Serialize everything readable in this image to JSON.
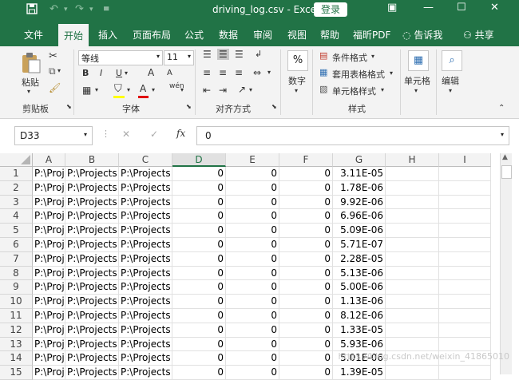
{
  "title": {
    "filename": "driving_log.csv",
    "separator": "-",
    "app": "Excel",
    "login_label": "登录"
  },
  "menu": [
    "文件",
    "开始",
    "插入",
    "页面布局",
    "公式",
    "数据",
    "审阅",
    "视图",
    "帮助",
    "福昕PDF"
  ],
  "tell_me": "告诉我",
  "share": "共享",
  "ribbon": {
    "clipboard": {
      "paste": "粘贴",
      "label": "剪贴板"
    },
    "font": {
      "name": "等线",
      "size": "11",
      "label": "字体",
      "bold": "B",
      "italic": "I",
      "underline": "U",
      "grow": "A",
      "shrink": "A",
      "color": "A",
      "phonetic": "wén"
    },
    "alignment": {
      "label": "对齐方式"
    },
    "number": {
      "icon": "%",
      "label": "数字"
    },
    "styles": {
      "conditional": "条件格式",
      "table": "套用表格格式",
      "cell_styles": "单元格样式",
      "label": "样式"
    },
    "cells": {
      "label": "单元格"
    },
    "editing": {
      "label": "编辑"
    }
  },
  "formula_bar": {
    "name_box": "D33",
    "cancel": "✕",
    "enter": "✓",
    "fx": "fx",
    "content": "0"
  },
  "grid": {
    "columns": [
      "A",
      "B",
      "C",
      "D",
      "E",
      "F",
      "G",
      "H",
      "I"
    ],
    "rows": [
      {
        "n": "1",
        "a": "P:\\Projects",
        "b": "P:\\Projects",
        "c": "P:\\Projects",
        "d": "0",
        "e": "0",
        "f": "0",
        "g": "3.11E-05"
      },
      {
        "n": "2",
        "a": "P:\\Projects",
        "b": "P:\\Projects",
        "c": "P:\\Projects",
        "d": "0",
        "e": "0",
        "f": "0",
        "g": "1.78E-06"
      },
      {
        "n": "3",
        "a": "P:\\Projects",
        "b": "P:\\Projects",
        "c": "P:\\Projects",
        "d": "0",
        "e": "0",
        "f": "0",
        "g": "9.92E-06"
      },
      {
        "n": "4",
        "a": "P:\\Projects",
        "b": "P:\\Projects",
        "c": "P:\\Projects",
        "d": "0",
        "e": "0",
        "f": "0",
        "g": "6.96E-06"
      },
      {
        "n": "5",
        "a": "P:\\Projects",
        "b": "P:\\Projects",
        "c": "P:\\Projects",
        "d": "0",
        "e": "0",
        "f": "0",
        "g": "5.09E-06"
      },
      {
        "n": "6",
        "a": "P:\\Projects",
        "b": "P:\\Projects",
        "c": "P:\\Projects",
        "d": "0",
        "e": "0",
        "f": "0",
        "g": "5.71E-07"
      },
      {
        "n": "7",
        "a": "P:\\Projects",
        "b": "P:\\Projects",
        "c": "P:\\Projects",
        "d": "0",
        "e": "0",
        "f": "0",
        "g": "2.28E-05"
      },
      {
        "n": "8",
        "a": "P:\\Projects",
        "b": "P:\\Projects",
        "c": "P:\\Projects",
        "d": "0",
        "e": "0",
        "f": "0",
        "g": "5.13E-06"
      },
      {
        "n": "9",
        "a": "P:\\Projects",
        "b": "P:\\Projects",
        "c": "P:\\Projects",
        "d": "0",
        "e": "0",
        "f": "0",
        "g": "5.00E-06"
      },
      {
        "n": "10",
        "a": "P:\\Projects",
        "b": "P:\\Projects",
        "c": "P:\\Projects",
        "d": "0",
        "e": "0",
        "f": "0",
        "g": "1.13E-06"
      },
      {
        "n": "11",
        "a": "P:\\Projects",
        "b": "P:\\Projects",
        "c": "P:\\Projects",
        "d": "0",
        "e": "0",
        "f": "0",
        "g": "8.12E-06"
      },
      {
        "n": "12",
        "a": "P:\\Projects",
        "b": "P:\\Projects",
        "c": "P:\\Projects",
        "d": "0",
        "e": "0",
        "f": "0",
        "g": "1.33E-05"
      },
      {
        "n": "13",
        "a": "P:\\Projects",
        "b": "P:\\Projects",
        "c": "P:\\Projects",
        "d": "0",
        "e": "0",
        "f": "0",
        "g": "5.93E-06"
      },
      {
        "n": "14",
        "a": "P:\\Projects",
        "b": "P:\\Projects",
        "c": "P:\\Projects",
        "d": "0",
        "e": "0",
        "f": "0",
        "g": "5.01E-06"
      },
      {
        "n": "15",
        "a": "P:\\Projects",
        "b": "P:\\Projects",
        "c": "P:\\Projects",
        "d": "0",
        "e": "0",
        "f": "0",
        "g": "1.39E-05"
      }
    ]
  },
  "watermark": "https://blog.csdn.net/weixin_41865010",
  "colors": {
    "excel_green": "#217346",
    "ribbon_bg": "#f3f3f3"
  }
}
